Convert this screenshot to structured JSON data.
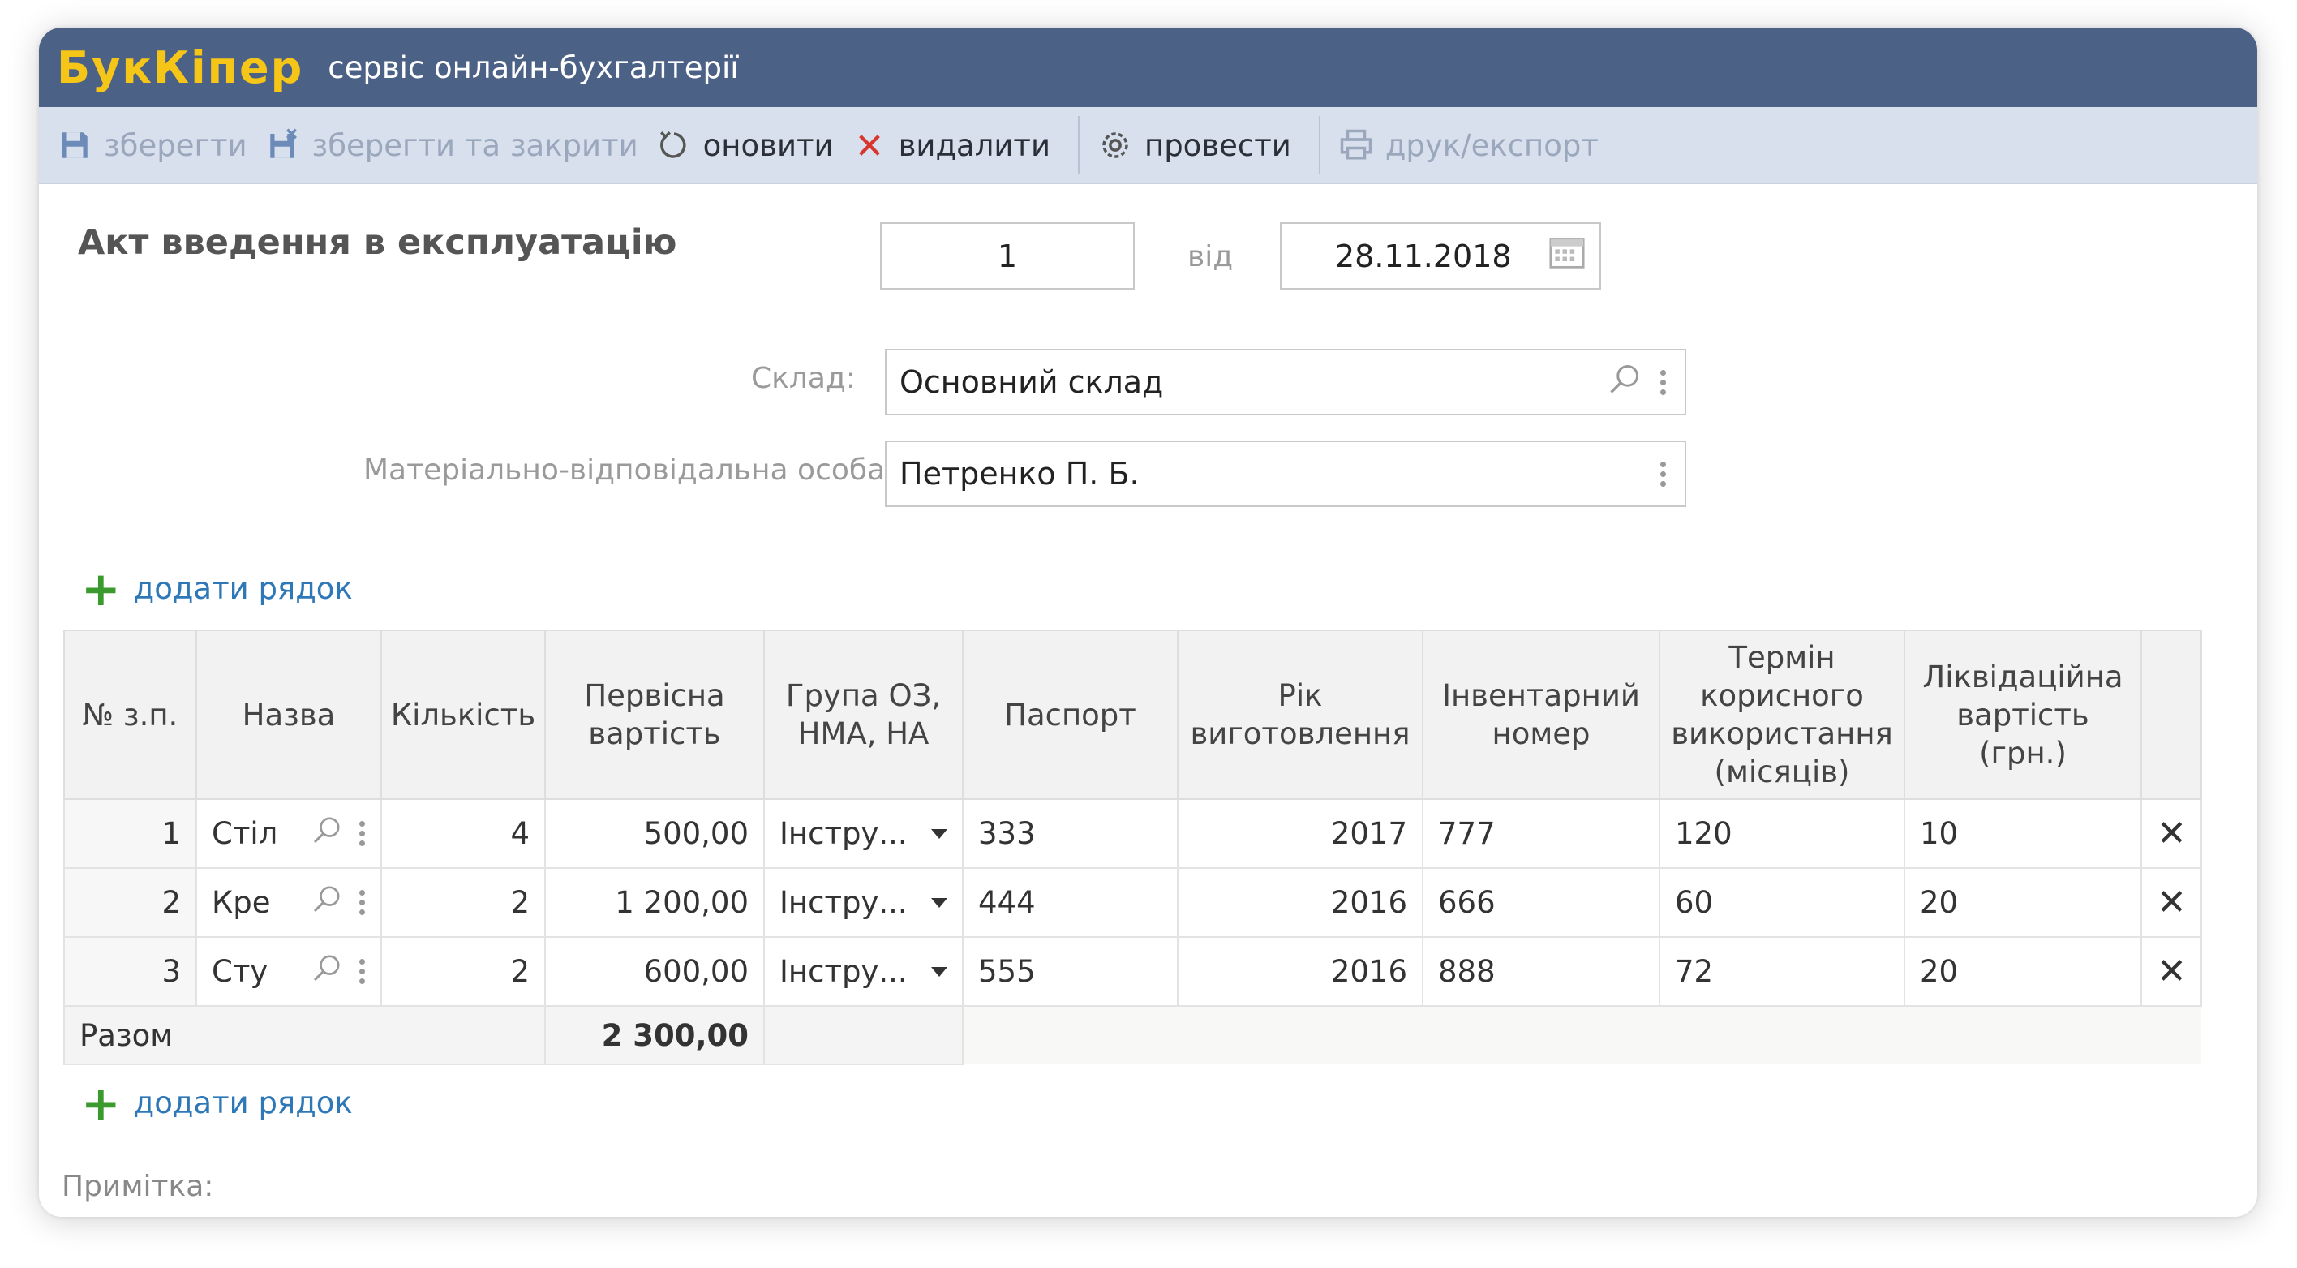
{
  "app": {
    "brand": "БукКіпер",
    "subtitle": "сервіс онлайн-бухгалтерії"
  },
  "toolbar": {
    "save": "зберегти",
    "save_close": "зберегти та закрити",
    "refresh": "оновити",
    "delete": "видалити",
    "post": "провести",
    "print": "друк/експорт"
  },
  "document": {
    "title": "Акт введення в експлуатацію",
    "number": "1",
    "from_label": "від",
    "date": "28.11.2018"
  },
  "form": {
    "warehouse_label": "Склад:",
    "warehouse_value": "Основний склад",
    "person_label": "Матеріально-відповідальна особа:",
    "person_value": "Петренко П. Б."
  },
  "add_row_label": "додати рядок",
  "table": {
    "headers": [
      "№ з.п.",
      "Назва",
      "Кількість",
      "Первісна вартість",
      "Група ОЗ, НМА, НА",
      "Паспорт",
      "Рік виготовлення",
      "Інвентарний номер",
      "Термін корисного використання (місяців)",
      "Ліквідаційна вартість (грн.)"
    ],
    "rows": [
      {
        "no": "1",
        "name": "Стіл",
        "qty": "4",
        "cost": "500,00",
        "group": "Інстру...",
        "passport": "333",
        "year": "2017",
        "inv": "777",
        "term": "120",
        "liq": "10"
      },
      {
        "no": "2",
        "name": "Кре",
        "qty": "2",
        "cost": "1 200,00",
        "group": "Інстру...",
        "passport": "444",
        "year": "2016",
        "inv": "666",
        "term": "60",
        "liq": "20"
      },
      {
        "no": "3",
        "name": "Сту",
        "qty": "2",
        "cost": "600,00",
        "group": "Інстру...",
        "passport": "555",
        "year": "2016",
        "inv": "888",
        "term": "72",
        "liq": "20"
      }
    ],
    "total_label": "Разом",
    "total_value": "2 300,00"
  },
  "note_label": "Примітка:"
}
